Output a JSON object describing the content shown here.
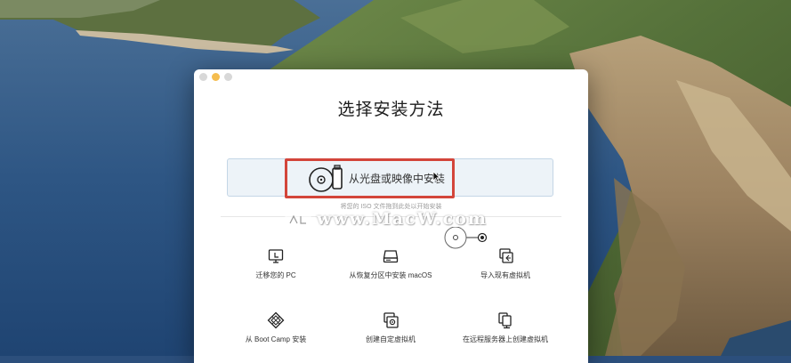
{
  "window": {
    "title": "选择安装方法"
  },
  "traffic_lights": {
    "close": "close-button",
    "minimize": "minimize-button",
    "zoom": "zoom-button"
  },
  "drop_zone": {
    "label": "从光盘或映像中安装",
    "icon": "disc-usb-icon",
    "hint": "将您的 ISO 文件拖到此处以开始安装"
  },
  "watermark": {
    "text": "www.MacW.com"
  },
  "options": [
    {
      "label": "迁移您的 PC",
      "icon": "migrate-pc-icon"
    },
    {
      "label": "从恢复分区中安装 macOS",
      "icon": "recovery-disk-icon"
    },
    {
      "label": "导入现有虚拟机",
      "icon": "import-vm-icon"
    },
    {
      "label": "从 Boot Camp 安装",
      "icon": "boot-camp-icon"
    },
    {
      "label": "创建自定虚拟机",
      "icon": "custom-vm-icon"
    },
    {
      "label": "在远程服务器上创建虚拟机",
      "icon": "remote-server-icon"
    }
  ],
  "colors": {
    "highlight_border": "#d3453a",
    "drop_zone_bg": "#edf3f8",
    "minimize": "#f5bd4f"
  }
}
